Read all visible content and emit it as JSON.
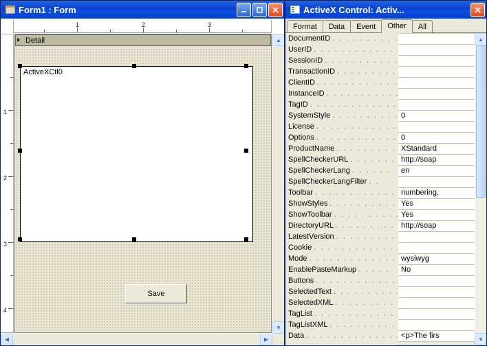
{
  "left": {
    "title": "Form1 : Form",
    "sectionLabel": "Detail",
    "controlLabel": "ActiveXCtl0",
    "buttonLabel": "Save",
    "rulerH": [
      "1",
      "2",
      "3"
    ],
    "rulerV": [
      "1",
      "2",
      "3",
      "4"
    ]
  },
  "right": {
    "title": "ActiveX Control: Activ...",
    "tabs": [
      "Format",
      "Data",
      "Event",
      "Other",
      "All"
    ],
    "activeTab": "Other",
    "props": [
      {
        "n": "DocumentID",
        "v": ""
      },
      {
        "n": "UserID",
        "v": ""
      },
      {
        "n": "SessionID",
        "v": ""
      },
      {
        "n": "TransactionID",
        "v": ""
      },
      {
        "n": "ClientID",
        "v": ""
      },
      {
        "n": "InstanceID",
        "v": ""
      },
      {
        "n": "TagID",
        "v": ""
      },
      {
        "n": "SystemStyle",
        "v": "0"
      },
      {
        "n": "License",
        "v": ""
      },
      {
        "n": "Options",
        "v": "0"
      },
      {
        "n": "ProductName",
        "v": "XStandard"
      },
      {
        "n": "SpellCheckerURL",
        "v": "http://soap"
      },
      {
        "n": "SpellCheckerLang",
        "v": "en"
      },
      {
        "n": "SpellCheckerLangFilter",
        "v": ""
      },
      {
        "n": "Toolbar",
        "v": "numbering,"
      },
      {
        "n": "ShowStyles",
        "v": "Yes"
      },
      {
        "n": "ShowToolbar",
        "v": "Yes"
      },
      {
        "n": "DirectoryURL",
        "v": "http://soap"
      },
      {
        "n": "LatestVersion",
        "v": ""
      },
      {
        "n": "Cookie",
        "v": ""
      },
      {
        "n": "Mode",
        "v": "wysiwyg"
      },
      {
        "n": "EnablePasteMarkup",
        "v": "No"
      },
      {
        "n": "Buttons",
        "v": ""
      },
      {
        "n": "SelectedText",
        "v": ""
      },
      {
        "n": "SelectedXML",
        "v": ""
      },
      {
        "n": "TagList",
        "v": ""
      },
      {
        "n": "TagListXML",
        "v": ""
      },
      {
        "n": "Data",
        "v": "<p>The firs"
      }
    ]
  }
}
